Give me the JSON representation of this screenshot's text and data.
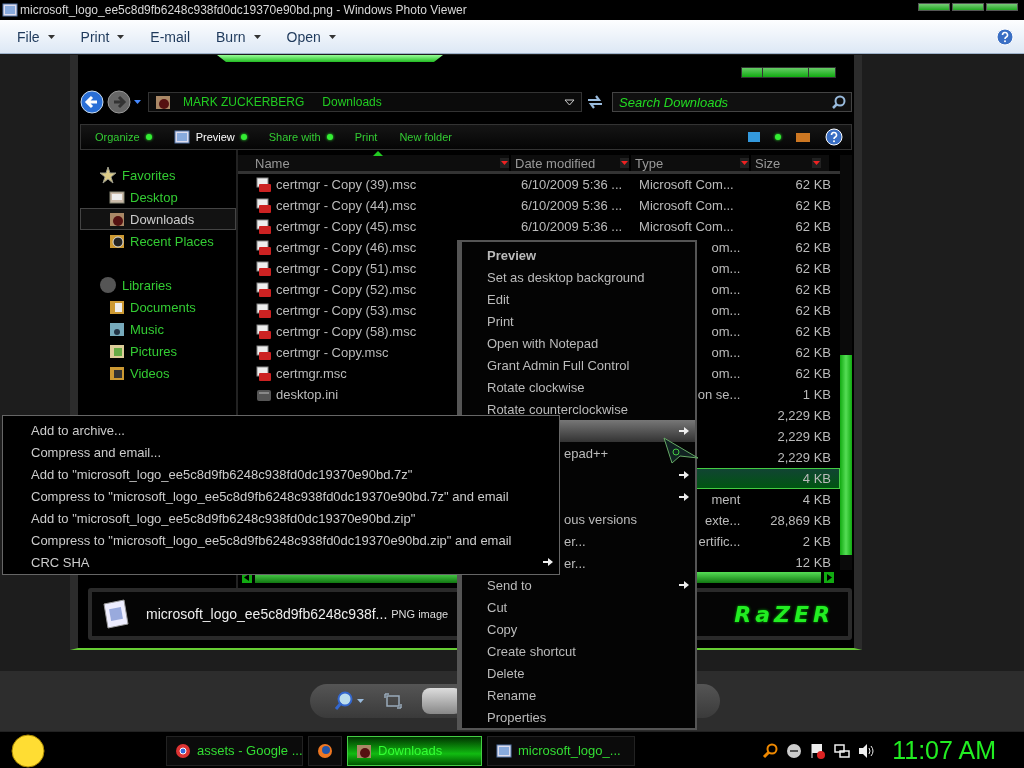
{
  "viewer": {
    "title": "microsoft_logo_ee5c8d9fb6248c938fd0dc19370e90bd.png - Windows Photo Viewer",
    "menu": [
      {
        "label": "File",
        "dropdown": true
      },
      {
        "label": "Print",
        "dropdown": true
      },
      {
        "label": "E-mail",
        "dropdown": false
      },
      {
        "label": "Burn",
        "dropdown": true
      },
      {
        "label": "Open",
        "dropdown": true
      }
    ]
  },
  "explorer": {
    "breadcrumb": [
      "MARK ZUCKERBERG",
      "Downloads"
    ],
    "search": {
      "placeholder": "Search Downloads"
    },
    "commands": [
      {
        "label": "Organize",
        "kind": "command",
        "dropdown": true
      },
      {
        "label": "Preview",
        "kind": "open-with",
        "dropdown": true
      },
      {
        "label": "Share with",
        "kind": "command",
        "dropdown": true
      },
      {
        "label": "Print",
        "kind": "command",
        "dropdown": false
      },
      {
        "label": "New folder",
        "kind": "command",
        "dropdown": false
      }
    ],
    "sidebar": [
      {
        "label": "Favorites",
        "selected": false,
        "children": [
          {
            "label": "Desktop",
            "selected": false
          },
          {
            "label": "Downloads",
            "selected": true
          },
          {
            "label": "Recent Places",
            "selected": false
          }
        ]
      },
      {
        "label": "Libraries",
        "selected": false,
        "children": [
          {
            "label": "Documents",
            "selected": false
          },
          {
            "label": "Music",
            "selected": false
          },
          {
            "label": "Pictures",
            "selected": false
          },
          {
            "label": "Videos",
            "selected": false
          }
        ]
      }
    ],
    "columns": [
      {
        "label": "Name",
        "sorted": true
      },
      {
        "label": "Date modified",
        "sorted": false
      },
      {
        "label": "Type",
        "sorted": false
      },
      {
        "label": "Size",
        "sorted": false
      }
    ],
    "rows": [
      {
        "kind": "msc",
        "name": "certmgr - Copy (39).msc",
        "date": "6/10/2009 5:36 ...",
        "type": "Microsoft Com...",
        "size": "62 KB",
        "selected": false
      },
      {
        "kind": "msc",
        "name": "certmgr - Copy (44).msc",
        "date": "6/10/2009 5:36 ...",
        "type": "Microsoft Com...",
        "size": "62 KB",
        "selected": false
      },
      {
        "kind": "msc",
        "name": "certmgr - Copy (45).msc",
        "date": "6/10/2009 5:36 ...",
        "type": "Microsoft Com...",
        "size": "62 KB",
        "selected": false
      },
      {
        "kind": "msc",
        "name": "certmgr - Copy (46).msc",
        "type": "om...",
        "size": "62 KB",
        "selected": false
      },
      {
        "kind": "msc",
        "name": "certmgr - Copy (51).msc",
        "type": "om...",
        "size": "62 KB",
        "selected": false
      },
      {
        "kind": "msc",
        "name": "certmgr - Copy (52).msc",
        "type": "om...",
        "size": "62 KB",
        "selected": false
      },
      {
        "kind": "msc",
        "name": "certmgr - Copy (53).msc",
        "type": "om...",
        "size": "62 KB",
        "selected": false
      },
      {
        "kind": "msc",
        "name": "certmgr - Copy (58).msc",
        "type": "om...",
        "size": "62 KB",
        "selected": false
      },
      {
        "kind": "msc",
        "name": "certmgr - Copy.msc",
        "type": "om...",
        "size": "62 KB",
        "selected": false
      },
      {
        "kind": "msc",
        "name": "certmgr.msc",
        "type": "om...",
        "size": "62 KB",
        "selected": false
      },
      {
        "kind": "ini",
        "name": "desktop.ini",
        "type": "on se...",
        "size": "1 KB",
        "selected": false
      },
      {
        "size": "2,229 KB",
        "selected": false
      },
      {
        "size": "2,229 KB",
        "selected": false
      },
      {
        "size": "2,229 KB",
        "selected": false
      },
      {
        "size": "4 KB",
        "selected": true
      },
      {
        "type": "ment",
        "size": "4 KB",
        "selected": false
      },
      {
        "type": " exte...",
        "size": "28,869 KB",
        "selected": false
      },
      {
        "type": "ertific...",
        "size": "2 KB",
        "selected": false
      },
      {
        "size": "12 KB",
        "selected": false
      }
    ],
    "details": {
      "filename": "microsoft_logo_ee5c8d9fb6248c938f...",
      "type": "PNG image"
    },
    "logo_text": "RaZER"
  },
  "context_menu": [
    {
      "label": "Preview",
      "kind": "default",
      "selected": false
    },
    {
      "label": "Set as desktop background",
      "kind": "item",
      "selected": false
    },
    {
      "label": "Edit",
      "kind": "item",
      "selected": false
    },
    {
      "label": "Print",
      "kind": "item",
      "selected": false
    },
    {
      "label": "Open with Notepad",
      "kind": "item",
      "selected": false
    },
    {
      "label": "Grant Admin Full Control",
      "kind": "item",
      "selected": false
    },
    {
      "label": "Rotate clockwise",
      "kind": "item",
      "selected": false
    },
    {
      "label": "Rotate counterclockwise",
      "kind": "item",
      "selected": false
    },
    {
      "kind": "submenu",
      "selected": true
    },
    {
      "label": "epad++",
      "kind": "partial",
      "selected": false
    },
    {
      "kind": "submenu",
      "selected": false
    },
    {
      "kind": "submenu",
      "selected": false
    },
    {
      "label": "ous versions",
      "kind": "partial",
      "selected": false
    },
    {
      "label": "er...",
      "kind": "partial",
      "selected": false
    },
    {
      "label": "er...",
      "kind": "partial",
      "selected": false
    },
    {
      "label": "Send to",
      "kind": "submenu",
      "selected": false
    },
    {
      "label": "Cut",
      "kind": "item",
      "selected": false
    },
    {
      "label": "Copy",
      "kind": "item",
      "selected": false
    },
    {
      "label": "Create shortcut",
      "kind": "item",
      "selected": false
    },
    {
      "label": "Delete",
      "kind": "item",
      "selected": false
    },
    {
      "label": "Rename",
      "kind": "item",
      "selected": false
    },
    {
      "label": "Properties",
      "kind": "item",
      "selected": false
    }
  ],
  "submenu": [
    {
      "label": "Add to archive...",
      "kind": "item"
    },
    {
      "label": "Compress and email...",
      "kind": "item"
    },
    {
      "label": "Add to \"microsoft_logo_ee5c8d9fb6248c938fd0dc19370e90bd.7z\"",
      "kind": "item"
    },
    {
      "label": "Compress to \"microsoft_logo_ee5c8d9fb6248c938fd0dc19370e90bd.7z\" and email",
      "kind": "item"
    },
    {
      "label": "Add to \"microsoft_logo_ee5c8d9fb6248c938fd0dc19370e90bd.zip\"",
      "kind": "item"
    },
    {
      "label": "Compress to \"microsoft_logo_ee5c8d9fb6248c938fd0dc19370e90bd.zip\" and email",
      "kind": "item"
    },
    {
      "label": "CRC SHA",
      "kind": "submenu"
    }
  ],
  "taskbar": {
    "buttons": [
      {
        "label": "assets - Google ...",
        "selected": false
      },
      {
        "selected": false
      },
      {
        "label": "Downloads",
        "selected": true
      },
      {
        "label": "microsoft_logo_...",
        "selected": false
      }
    ],
    "clock": "11:07 AM"
  }
}
